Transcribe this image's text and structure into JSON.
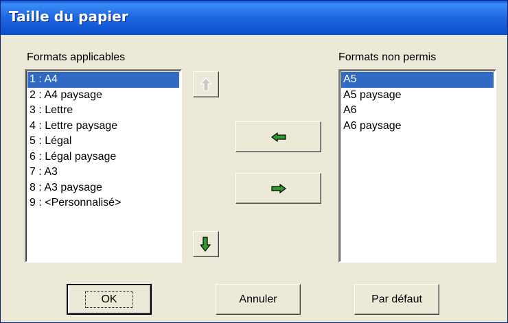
{
  "window": {
    "title": "Taille du papier"
  },
  "left_panel": {
    "label": "Formats applicables",
    "items": [
      "1 : A4",
      "2 : A4 paysage",
      "3 : Lettre",
      "4 : Lettre paysage",
      "5 : Légal",
      "6 : Légal paysage",
      "7 : A3",
      "8 : A3 paysage",
      "9 : <Personnalisé>"
    ],
    "selected_index": 0
  },
  "right_panel": {
    "label": "Formats non permis",
    "items": [
      "A5",
      "A5 paysage",
      "A6",
      "A6 paysage"
    ],
    "selected_index": 0
  },
  "buttons": {
    "ok": "OK",
    "cancel": "Annuler",
    "default": "Par défaut"
  },
  "icons": {
    "move_up": "arrow-up-icon",
    "move_down": "arrow-down-icon",
    "move_left": "arrow-left-icon",
    "move_right": "arrow-right-icon",
    "arrow_color": "#2f9a2f",
    "disabled_color": "#c0c0c0"
  }
}
